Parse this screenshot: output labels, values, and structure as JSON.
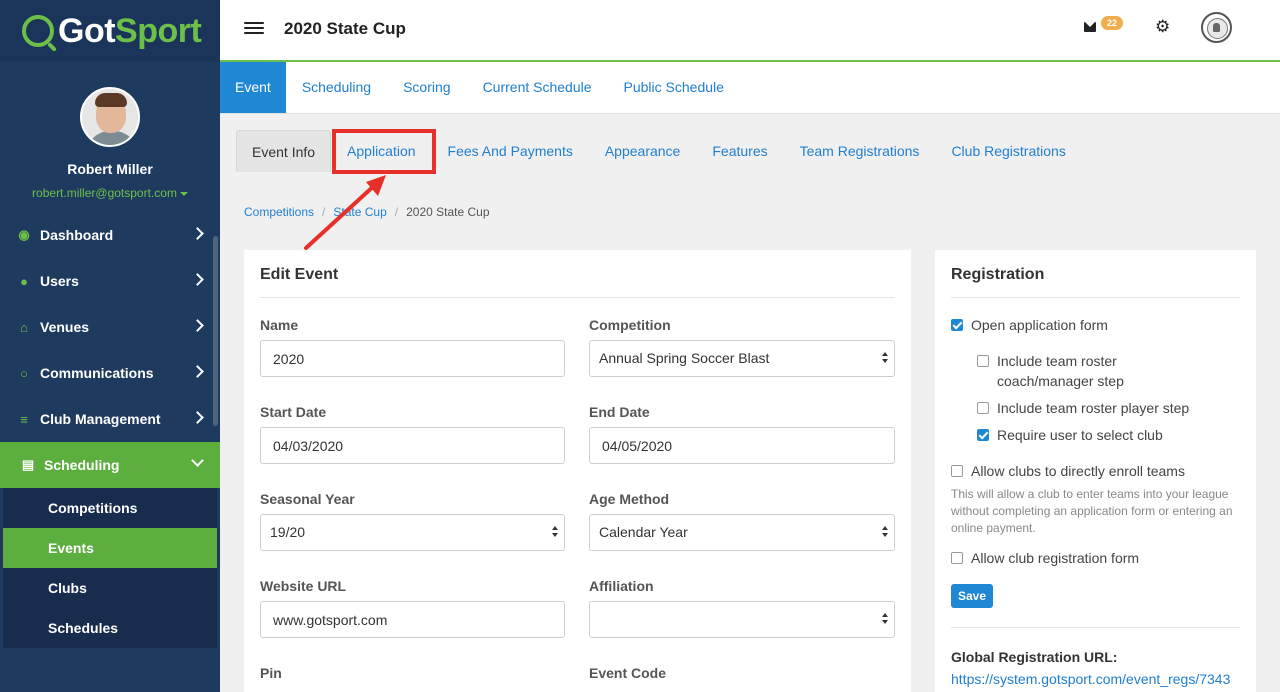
{
  "app": {
    "logo_got": "Got",
    "logo_sport": "Sport"
  },
  "user": {
    "name": "Robert Miller",
    "email": "robert.miller@gotsport.com"
  },
  "sidebar": {
    "items": [
      {
        "label": "Dashboard",
        "icon": "dashboard-icon"
      },
      {
        "label": "Users",
        "icon": "users-icon"
      },
      {
        "label": "Venues",
        "icon": "home-icon"
      },
      {
        "label": "Communications",
        "icon": "chat-icon"
      },
      {
        "label": "Club Management",
        "icon": "list-icon"
      },
      {
        "label": "Scheduling",
        "icon": "calendar-icon",
        "active": true
      }
    ],
    "subitems": [
      {
        "label": "Competitions"
      },
      {
        "label": "Events",
        "active": true
      },
      {
        "label": "Clubs"
      },
      {
        "label": "Schedules"
      }
    ]
  },
  "header": {
    "title": "2020 State Cup",
    "mail_count": "22"
  },
  "main_tabs": [
    "Event",
    "Scheduling",
    "Scoring",
    "Current Schedule",
    "Public Schedule"
  ],
  "sub_tabs": [
    "Event Info",
    "Application",
    "Fees And Payments",
    "Appearance",
    "Features",
    "Team Registrations",
    "Club Registrations"
  ],
  "breadcrumb": [
    "Competitions",
    "State Cup",
    "2020 State Cup"
  ],
  "edit_event": {
    "title": "Edit Event",
    "name_label": "Name",
    "name_value": "2020",
    "competition_label": "Competition",
    "competition_value": "Annual Spring Soccer Blast",
    "start_date_label": "Start Date",
    "start_date_value": "04/03/2020",
    "end_date_label": "End Date",
    "end_date_value": "04/05/2020",
    "seasonal_year_label": "Seasonal Year",
    "seasonal_year_value": "19/20",
    "age_method_label": "Age Method",
    "age_method_value": "Calendar Year",
    "website_label": "Website URL",
    "website_value": "www.gotsport.com",
    "affiliation_label": "Affiliation",
    "affiliation_value": "",
    "pin_label": "Pin",
    "event_code_label": "Event Code"
  },
  "registration": {
    "title": "Registration",
    "open_form": "Open application form",
    "roster_coach": "Include team roster coach/manager step",
    "roster_player": "Include team roster player step",
    "require_club": "Require user to select club",
    "allow_enroll": "Allow clubs to directly enroll teams",
    "help_text": "This will allow a club to enter teams into your league without completing an application form or entering an online payment.",
    "allow_club_form": "Allow club registration form",
    "save_label": "Save",
    "global_url_label": "Global Registration URL:",
    "global_url": "https://system.gotsport.com/event_regs/7343"
  }
}
